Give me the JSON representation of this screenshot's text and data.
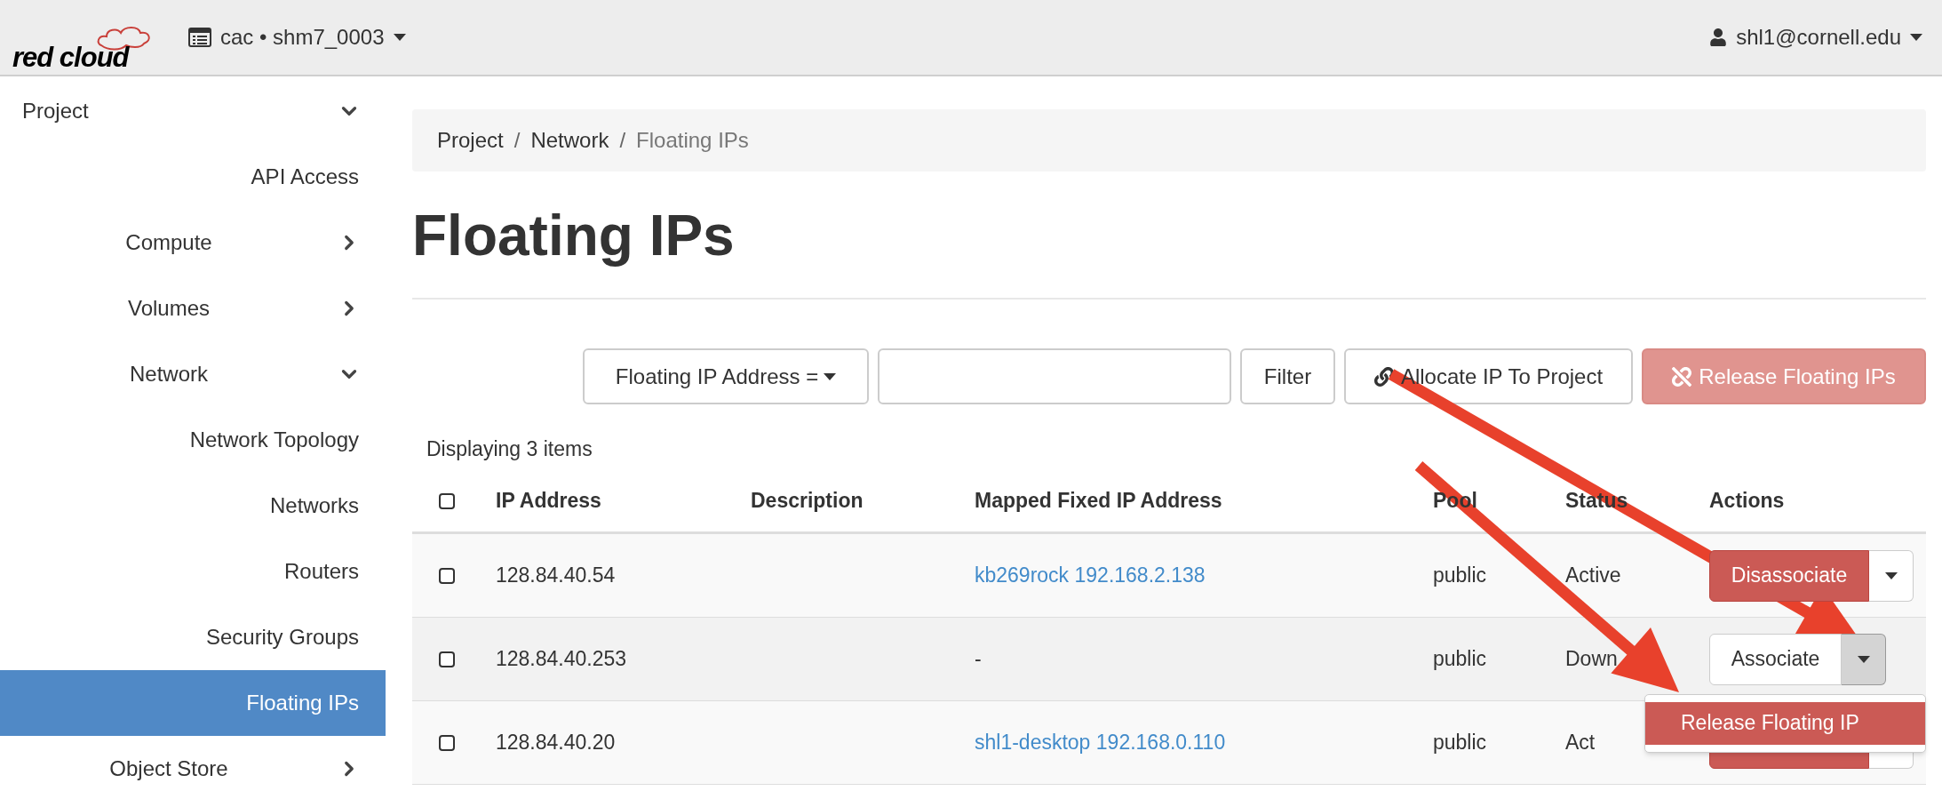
{
  "logo": "red cloud",
  "project_picker": {
    "label": "cac • shm7_0003"
  },
  "user_menu": {
    "label": "shl1@cornell.edu"
  },
  "sidebar": {
    "items": [
      {
        "label": "Project",
        "kind": "group",
        "expanded": true,
        "children": [
          {
            "label": "API Access",
            "kind": "link",
            "selected": false
          },
          {
            "label": "Compute",
            "kind": "group",
            "expanded": false
          },
          {
            "label": "Volumes",
            "kind": "group",
            "expanded": false
          },
          {
            "label": "Network",
            "kind": "group",
            "expanded": true,
            "children": [
              {
                "label": "Network Topology",
                "kind": "link",
                "selected": false
              },
              {
                "label": "Networks",
                "kind": "link",
                "selected": false
              },
              {
                "label": "Routers",
                "kind": "link",
                "selected": false
              },
              {
                "label": "Security Groups",
                "kind": "link",
                "selected": false
              },
              {
                "label": "Floating IPs",
                "kind": "link",
                "selected": true
              }
            ]
          },
          {
            "label": "Object Store",
            "kind": "group",
            "expanded": false
          }
        ]
      }
    ]
  },
  "breadcrumb": {
    "items": [
      "Project",
      "Network",
      "Floating IPs"
    ],
    "separator": "/"
  },
  "title": "Floating IPs",
  "toolbar": {
    "filter_select": "Floating IP Address =",
    "filter_button": "Filter",
    "allocate_button": "Allocate IP To Project",
    "release_button": {
      "label": "Release Floating IPs",
      "disabled": true
    }
  },
  "count": "Displaying 3 items",
  "table": {
    "header_checked": false,
    "columns": [
      "IP Address",
      "Description",
      "Mapped Fixed IP Address",
      "Pool",
      "Status",
      "Actions"
    ],
    "rows": [
      {
        "checked": false,
        "ip": "128.84.40.54",
        "mapped": {
          "kind": "link",
          "text": "kb269rock 192.168.2.138"
        },
        "pool": "public",
        "status": "Active",
        "action": {
          "kind": "danger",
          "label": "Disassociate",
          "open": false
        }
      },
      {
        "checked": false,
        "ip": "128.84.40.253",
        "mapped": {
          "kind": "text",
          "text": "-"
        },
        "pool": "public",
        "status": "Down",
        "action": {
          "kind": "default",
          "label": "Associate",
          "open": true,
          "menu": [
            {
              "label": "Release Floating IP",
              "selected": true
            }
          ]
        }
      },
      {
        "checked": false,
        "ip": "128.84.40.20",
        "mapped": {
          "kind": "link",
          "text": "shl1-desktop 192.168.0.110"
        },
        "pool": "public",
        "status": "Act",
        "action": {
          "kind": "danger",
          "open": false
        }
      }
    ]
  }
}
